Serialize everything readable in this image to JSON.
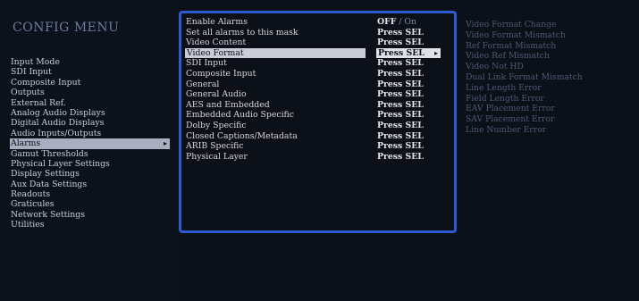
{
  "config_menu": {
    "title": "CONFIG MENU",
    "items": [
      {
        "label": "Input Mode",
        "selected": false
      },
      {
        "label": "SDI Input",
        "selected": false
      },
      {
        "label": "Composite Input",
        "selected": false
      },
      {
        "label": "Outputs",
        "selected": false
      },
      {
        "label": "External Ref.",
        "selected": false
      },
      {
        "label": "Analog Audio Displays",
        "selected": false
      },
      {
        "label": "Digital Audio Displays",
        "selected": false
      },
      {
        "label": "Audio Inputs/Outputs",
        "selected": false
      },
      {
        "label": "Alarms",
        "selected": true
      },
      {
        "label": "Gamut Thresholds",
        "selected": false
      },
      {
        "label": "Physical Layer Settings",
        "selected": false
      },
      {
        "label": "Display Settings",
        "selected": false
      },
      {
        "label": "Aux Data Settings",
        "selected": false
      },
      {
        "label": "Readouts",
        "selected": false
      },
      {
        "label": "Graticules",
        "selected": false
      },
      {
        "label": "Network Settings",
        "selected": false
      },
      {
        "label": "Utilities",
        "selected": false
      }
    ],
    "selected_arrow": "▸"
  },
  "alarms_menu": {
    "items": [
      {
        "label": "Enable Alarms",
        "value": "OFF",
        "value_sep": " / ",
        "value_alt": "On",
        "selected": false
      },
      {
        "label": "Set all alarms to this mask",
        "value": "Press SEL",
        "selected": false
      },
      {
        "label": "Video Content",
        "value": "Press SEL",
        "selected": false
      },
      {
        "label": "Video Format",
        "value": "Press SEL",
        "selected": true
      },
      {
        "label": "SDI Input",
        "value": "Press SEL",
        "selected": false
      },
      {
        "label": "Composite Input",
        "value": "Press SEL",
        "selected": false
      },
      {
        "label": "General",
        "value": "Press SEL",
        "selected": false
      },
      {
        "label": "General Audio",
        "value": "Press SEL",
        "selected": false
      },
      {
        "label": "AES and Embedded",
        "value": "Press SEL",
        "selected": false
      },
      {
        "label": "Embedded Audio Specific",
        "value": "Press SEL",
        "selected": false
      },
      {
        "label": "Dolby Specific",
        "value": "Press SEL",
        "selected": false
      },
      {
        "label": "Closed Captions/Metadata",
        "value": "Press SEL",
        "selected": false
      },
      {
        "label": "ARIB Specific",
        "value": "Press SEL",
        "selected": false
      },
      {
        "label": "Physical Layer",
        "value": "Press SEL",
        "selected": false
      }
    ],
    "selected_caret": "▸"
  },
  "video_format_submenu": {
    "items": [
      "Video Format Change",
      "Video Format Mismatch",
      "Ref Format Mismatch",
      "Video Ref Mismatch",
      "Video Not HD",
      "Dual Link Format Mismatch",
      "Line Length Error",
      "Field Length Error",
      "EAV Placement Error",
      "SAV Placement Error",
      "Line Number Error"
    ]
  },
  "colors": {
    "background": "#0b1019",
    "panel_border": "#2e5bd1",
    "highlight": "#c9ccd6",
    "text": "#d4d6dc",
    "dim_text": "#4e5873"
  }
}
